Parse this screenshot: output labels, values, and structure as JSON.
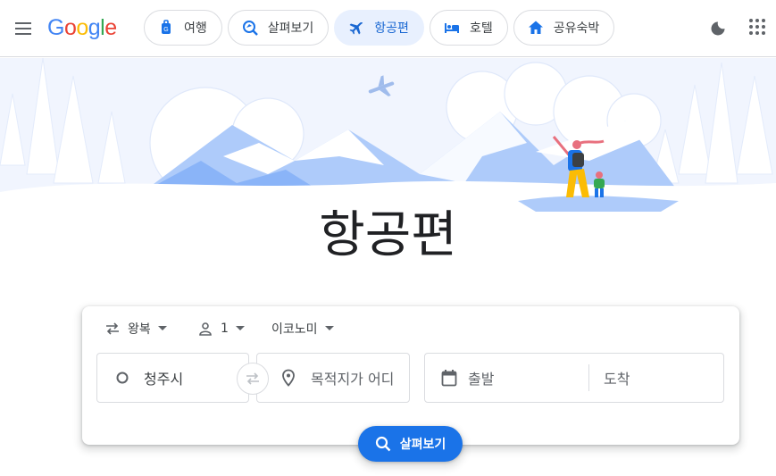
{
  "header": {
    "logo": [
      "G",
      "o",
      "o",
      "g",
      "l",
      "e"
    ],
    "nav": [
      {
        "label": "여행",
        "icon": "travel-bag-icon"
      },
      {
        "label": "살펴보기",
        "icon": "explore-icon"
      },
      {
        "label": "항공편",
        "icon": "flight-icon",
        "active": true
      },
      {
        "label": "호텔",
        "icon": "hotel-bed-icon"
      },
      {
        "label": "공유숙박",
        "icon": "home-icon"
      }
    ],
    "menu_icon": "hamburger-menu-icon",
    "theme_icon": "dark-mode-moon-icon",
    "apps_icon": "apps-grid-icon"
  },
  "hero": {
    "title": "항공편",
    "illustration": "snowy-mountains-with-hikers"
  },
  "search": {
    "trip_type": "왕복",
    "passengers": "1",
    "cabin_class": "이코노미",
    "origin": "청주시",
    "destination_placeholder": "목적지가 어디",
    "depart_placeholder": "출발",
    "return_placeholder": "도착",
    "button_label": "살펴보기"
  },
  "colors": {
    "accent": "#1a73e8",
    "active_chip_bg": "#e8f0fe",
    "active_chip_text": "#1967d2",
    "hero_blue": "#aecbfa"
  }
}
